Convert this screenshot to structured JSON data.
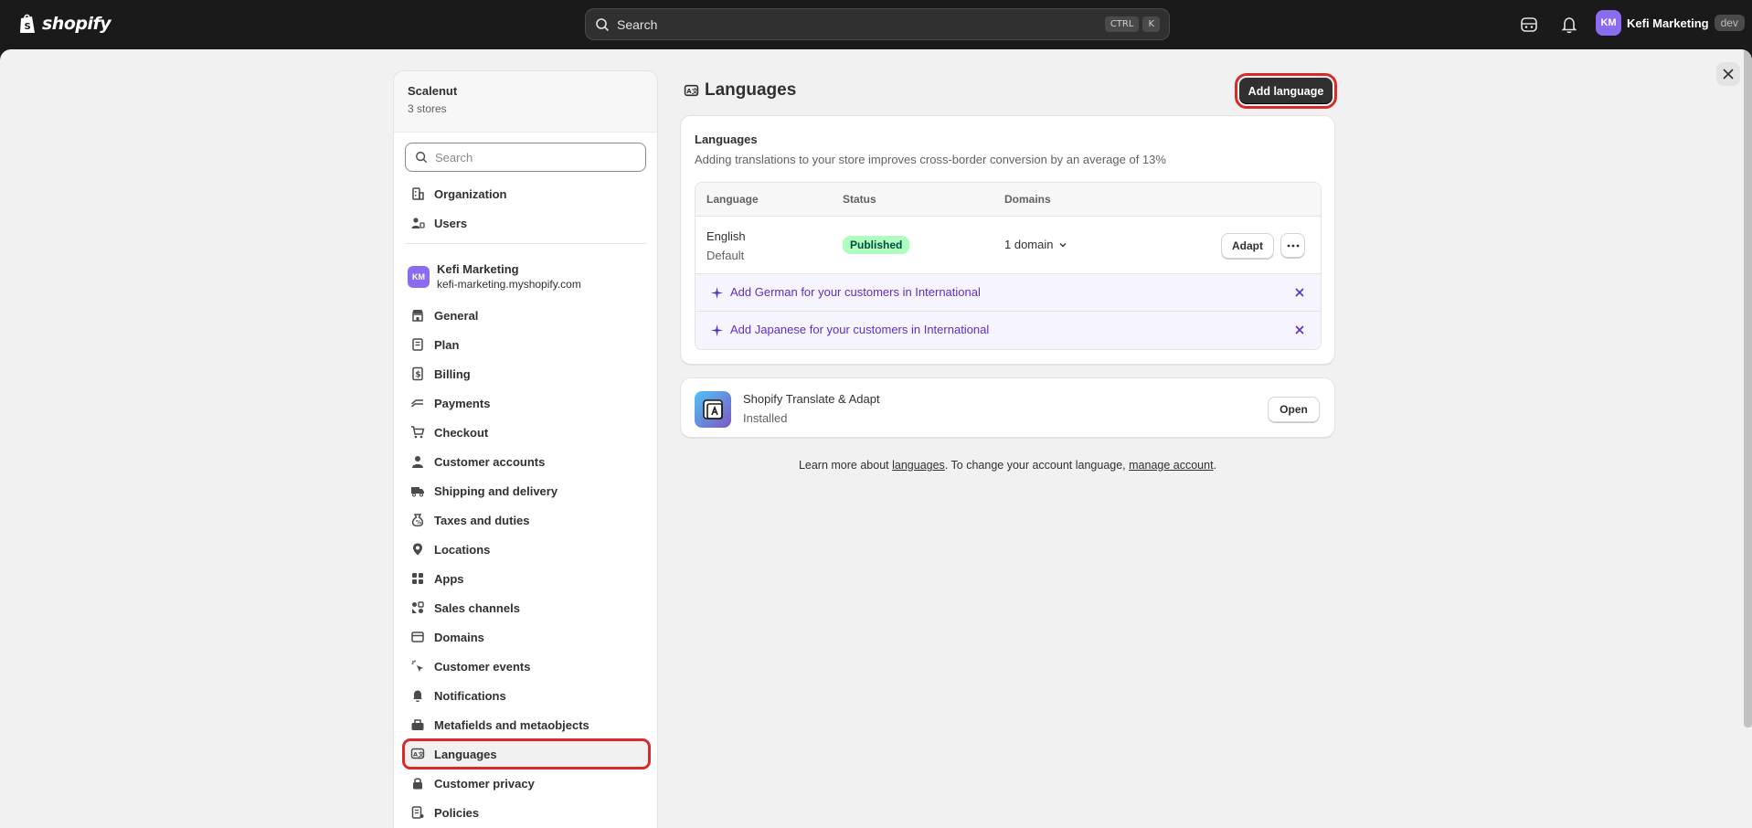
{
  "topbar": {
    "logo_text": "shopify",
    "search_placeholder": "Search",
    "kbd_ctrl": "CTRL",
    "kbd_k": "K",
    "account_initials": "KM",
    "account_name": "Kefi Marketing",
    "env_badge": "dev"
  },
  "sidebar": {
    "org_name": "Scalenut",
    "org_sub": "3 stores",
    "search_placeholder": "Search",
    "org_items": [
      {
        "label": "Organization",
        "icon": "building-icon"
      },
      {
        "label": "Users",
        "icon": "users-icon"
      }
    ],
    "store": {
      "initials": "KM",
      "name": "Kefi Marketing",
      "url": "kefi-marketing.myshopify.com"
    },
    "items": [
      {
        "label": "General",
        "icon": "store-icon"
      },
      {
        "label": "Plan",
        "icon": "plan-icon"
      },
      {
        "label": "Billing",
        "icon": "billing-icon"
      },
      {
        "label": "Payments",
        "icon": "payments-icon"
      },
      {
        "label": "Checkout",
        "icon": "cart-icon"
      },
      {
        "label": "Customer accounts",
        "icon": "person-icon"
      },
      {
        "label": "Shipping and delivery",
        "icon": "truck-icon"
      },
      {
        "label": "Taxes and duties",
        "icon": "tax-icon"
      },
      {
        "label": "Locations",
        "icon": "location-icon"
      },
      {
        "label": "Apps",
        "icon": "apps-icon"
      },
      {
        "label": "Sales channels",
        "icon": "channels-icon"
      },
      {
        "label": "Domains",
        "icon": "globe-icon"
      },
      {
        "label": "Customer events",
        "icon": "cursor-icon"
      },
      {
        "label": "Notifications",
        "icon": "bell-icon"
      },
      {
        "label": "Metafields and metaobjects",
        "icon": "metafields-icon"
      },
      {
        "label": "Languages",
        "icon": "language-icon",
        "active": true
      },
      {
        "label": "Customer privacy",
        "icon": "lock-icon"
      },
      {
        "label": "Policies",
        "icon": "policy-icon"
      }
    ]
  },
  "main": {
    "title": "Languages",
    "add_button": "Add language",
    "card": {
      "title": "Languages",
      "subtitle": "Adding translations to your store improves cross-border conversion by an average of 13%",
      "columns": [
        "Language",
        "Status",
        "Domains"
      ],
      "rows": [
        {
          "language": "English",
          "note": "Default",
          "status": "Published",
          "domains": "1 domain",
          "action": "Adapt"
        }
      ],
      "suggestions": [
        "Add German for your customers in International",
        "Add Japanese for your customers in International"
      ]
    },
    "app": {
      "name": "Shopify Translate & Adapt",
      "status": "Installed",
      "button": "Open"
    },
    "footer": {
      "prefix": "Learn more about ",
      "link1": "languages",
      "middle": ". To change your account language, ",
      "link2": "manage account",
      "suffix": "."
    }
  },
  "colors": {
    "accent_purple": "#5c2fc2",
    "published_bg": "#affebf",
    "highlight": "#d72a2a"
  }
}
